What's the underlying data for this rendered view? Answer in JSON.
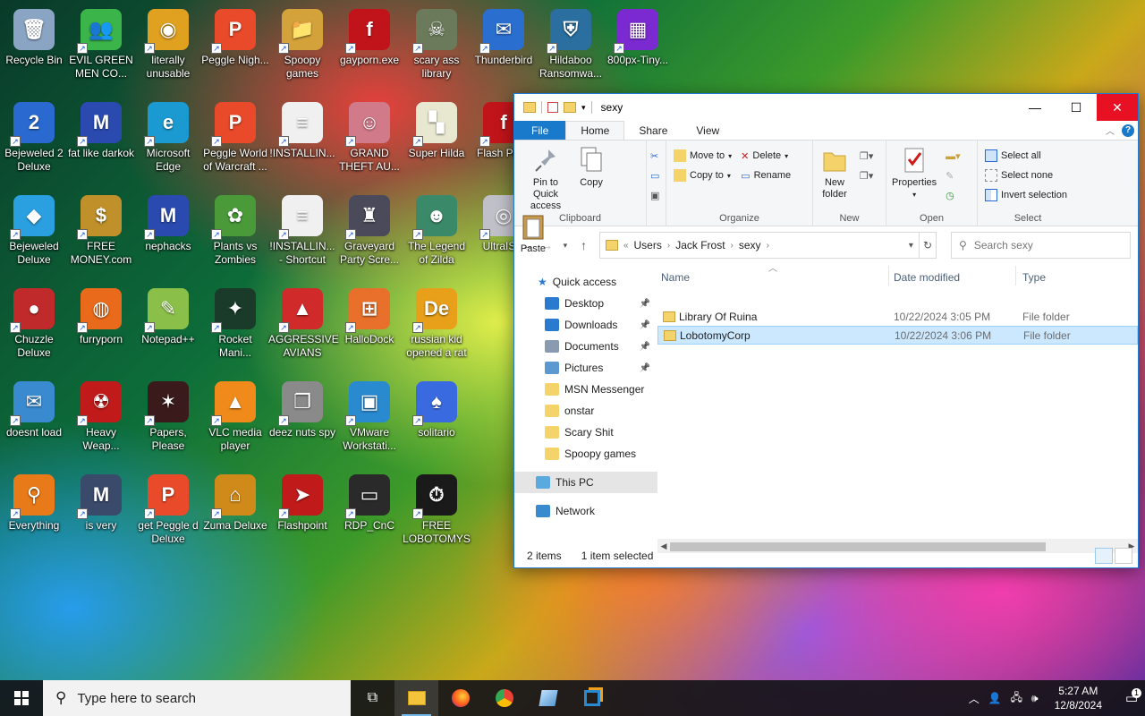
{
  "desktop_icons": [
    {
      "label": "Recycle Bin",
      "color": "#8aa4c4",
      "glyph": "🗑"
    },
    {
      "label": "EVIL GREEN MEN CO...",
      "color": "#3bb54a",
      "glyph": "👥"
    },
    {
      "label": "literally unusable",
      "color": "#e0a020",
      "glyph": "◉"
    },
    {
      "label": "Peggle Nigh...",
      "color": "#e84a2a",
      "glyph": "P"
    },
    {
      "label": "Spoopy games",
      "color": "#d4a23a",
      "glyph": "📁"
    },
    {
      "label": "gayporn.exe",
      "color": "#c0141a",
      "glyph": "f"
    },
    {
      "label": "scary ass library",
      "color": "#6a7a5a",
      "glyph": "☠"
    },
    {
      "label": "Thunderbird",
      "color": "#2a6fd0",
      "glyph": "✉"
    },
    {
      "label": "Hildaboo Ransomwa...",
      "color": "#2a6fa0",
      "glyph": "⛨"
    },
    {
      "label": "800px-Tiny...",
      "color": "#7a2ad0",
      "glyph": "▦"
    },
    {
      "label": "Bejeweled 2 Deluxe",
      "color": "#2a6ad0",
      "glyph": "2"
    },
    {
      "label": "fat like darkok",
      "color": "#2a4ab0",
      "glyph": "M"
    },
    {
      "label": "Microsoft Edge",
      "color": "#1a9ad0",
      "glyph": "e"
    },
    {
      "label": "Peggle World of Warcraft ...",
      "color": "#e84a2a",
      "glyph": "P"
    },
    {
      "label": "!INSTALLIN...",
      "color": "#f0f0f0",
      "glyph": "≡"
    },
    {
      "label": "GRAND THEFT AU...",
      "color": "#d07a8a",
      "glyph": "☺"
    },
    {
      "label": "Super Hilda",
      "color": "#e8e8d0",
      "glyph": "▚"
    },
    {
      "label": "Flash Pla...",
      "color": "#c0141a",
      "glyph": "f"
    },
    {
      "label": "Bejeweled Deluxe",
      "color": "#2aa0e0",
      "glyph": "◆"
    },
    {
      "label": "FREE MONEY.com",
      "color": "#c0902a",
      "glyph": "$"
    },
    {
      "label": "nephacks",
      "color": "#2a4ab0",
      "glyph": "M"
    },
    {
      "label": "Plants vs Zombies",
      "color": "#4a9a3a",
      "glyph": "✿"
    },
    {
      "label": "!INSTALLIN... - Shortcut",
      "color": "#f0f0f0",
      "glyph": "≡"
    },
    {
      "label": "Graveyard Party Scre...",
      "color": "#4a4a5a",
      "glyph": "♜"
    },
    {
      "label": "The Legend of Zilda",
      "color": "#3a8a6a",
      "glyph": "☻"
    },
    {
      "label": "UltraIS...",
      "color": "#c0c0c8",
      "glyph": "◎"
    },
    {
      "label": "Chuzzle Deluxe",
      "color": "#c02a2a",
      "glyph": "●"
    },
    {
      "label": "furryporn",
      "color": "#e86a1a",
      "glyph": "◍"
    },
    {
      "label": "Notepad++",
      "color": "#8ac04a",
      "glyph": "✎"
    },
    {
      "label": "Rocket Mani...",
      "color": "#1a3a2a",
      "glyph": "✦"
    },
    {
      "label": "AGGRESSIVE AVIANS",
      "color": "#d02a2a",
      "glyph": "▲"
    },
    {
      "label": "HalloDock",
      "color": "#e8702a",
      "glyph": "⊞"
    },
    {
      "label": "russian kid opened a rat",
      "color": "#e8a01a",
      "glyph": "De"
    },
    {
      "label": "doesnt load",
      "color": "#3a8ad0",
      "glyph": "✉"
    },
    {
      "label": "Heavy Weap...",
      "color": "#c01a1a",
      "glyph": "☢"
    },
    {
      "label": "Papers, Please",
      "color": "#3a1a1a",
      "glyph": "✶"
    },
    {
      "label": "VLC media player",
      "color": "#f08a1a",
      "glyph": "▲"
    },
    {
      "label": "deez nuts spy",
      "color": "#8a8a8a",
      "glyph": "❐"
    },
    {
      "label": "VMware Workstati...",
      "color": "#2a8ad0",
      "glyph": "▣"
    },
    {
      "label": "solitario",
      "color": "#3a6ae0",
      "glyph": "♠"
    },
    {
      "label": "Everything",
      "color": "#e87a1a",
      "glyph": "⚲"
    },
    {
      "label": "is very",
      "color": "#3a4a6a",
      "glyph": "M"
    },
    {
      "label": "get Peggle d Deluxe",
      "color": "#e84a2a",
      "glyph": "P"
    },
    {
      "label": "Zuma Deluxe",
      "color": "#d08a1a",
      "glyph": "⌂"
    },
    {
      "label": "Flashpoint",
      "color": "#c01a1a",
      "glyph": "➤"
    },
    {
      "label": "RDP_CnC",
      "color": "#2a2a2a",
      "glyph": "▭"
    },
    {
      "label": "FREE LOBOTOMYS",
      "color": "#1a1a1a",
      "glyph": "⏱"
    }
  ],
  "explorer": {
    "title": "sexy",
    "tabs": {
      "file": "File",
      "home": "Home",
      "share": "Share",
      "view": "View"
    },
    "ribbon": {
      "clipboard": {
        "name": "Clipboard",
        "pin": "Pin to Quick access",
        "copy": "Copy",
        "paste": "Paste"
      },
      "organize": {
        "name": "Organize",
        "move_to": "Move to",
        "copy_to": "Copy to",
        "delete": "Delete",
        "rename": "Rename"
      },
      "new": {
        "name": "New",
        "new_folder": "New folder"
      },
      "open": {
        "name": "Open",
        "properties": "Properties"
      },
      "select": {
        "name": "Select",
        "select_all": "Select all",
        "select_none": "Select none",
        "invert": "Invert selection"
      }
    },
    "address": {
      "crumbs": [
        "Users",
        "Jack Frost",
        "sexy"
      ]
    },
    "search": {
      "placeholder": "Search sexy"
    },
    "nav_pane": {
      "quick_access": "Quick access",
      "items": [
        {
          "label": "Desktop",
          "pinned": true,
          "color": "#2a7ad0"
        },
        {
          "label": "Downloads",
          "pinned": true,
          "color": "#2a7ad0"
        },
        {
          "label": "Documents",
          "pinned": true,
          "color": "#8a9ab0"
        },
        {
          "label": "Pictures",
          "pinned": true,
          "color": "#5a9ad0"
        },
        {
          "label": "MSN Messenger",
          "pinned": false,
          "color": "#f4d36b"
        },
        {
          "label": "onstar",
          "pinned": false,
          "color": "#f4d36b"
        },
        {
          "label": "Scary Shit",
          "pinned": false,
          "color": "#f4d36b"
        },
        {
          "label": "Spoopy games",
          "pinned": false,
          "color": "#f4d36b"
        }
      ],
      "this_pc": "This PC",
      "network": "Network"
    },
    "columns": {
      "name": "Name",
      "date": "Date modified",
      "type": "Type"
    },
    "files": [
      {
        "name": "Library Of Ruina",
        "date": "10/22/2024 3:05 PM",
        "type": "File folder"
      },
      {
        "name": "LobotomyCorp",
        "date": "10/22/2024 3:06 PM",
        "type": "File folder"
      }
    ],
    "status": {
      "count": "2 items",
      "selected": "1 item selected"
    }
  },
  "taskbar": {
    "search_placeholder": "Type here to search",
    "time": "5:27 AM",
    "date": "12/8/2024"
  }
}
